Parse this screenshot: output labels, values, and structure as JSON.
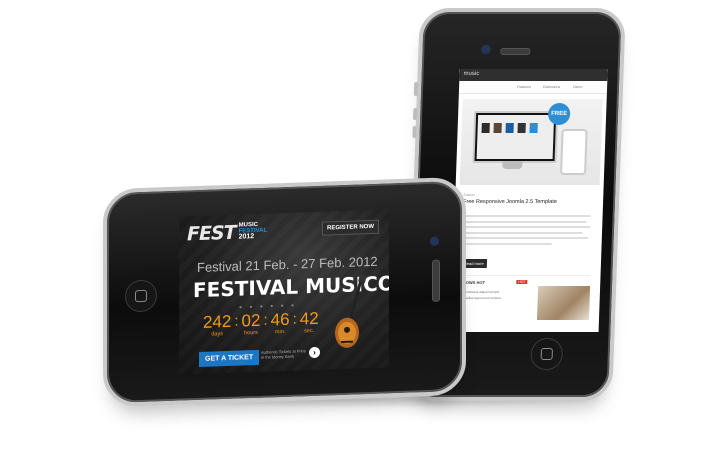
{
  "landscape_screen": {
    "logo_main": "FEST",
    "logo_music": "MUSIC",
    "logo_festival": "FESTIVAL",
    "logo_year": "2012",
    "register_label": "REGISTER NOW",
    "dates": "Festival 21 Feb. - 27 Feb. 2012",
    "title": "FESTIVAL MUSICO",
    "countdown": [
      {
        "value": "242",
        "unit": "days"
      },
      {
        "value": "02",
        "unit": "hours"
      },
      {
        "value": "46",
        "unit": "min."
      },
      {
        "value": "42",
        "unit": "sec."
      }
    ],
    "ticket_label": "GET A TICKET",
    "ticket_sub": "Authentic Tickets at Price in the Money Bank",
    "arrow": "›",
    "accent": "#f29a1a",
    "button_color": "#1d76c4"
  },
  "portrait_screen": {
    "logo": "music",
    "nav": [
      "Features",
      "Extensions",
      "Demo"
    ],
    "badge": "FREE",
    "category": "Articles",
    "heading": "Free Responsive Joomla 2.5 Template",
    "read_more": "Read more",
    "widget_title": "SHOWS HOT",
    "widget_badge": "HOT",
    "widget_items": [
      "Pellentesque aliquet tempor",
      "Phasellus eget purus tempus"
    ],
    "badge_color": "#2c8fd6"
  }
}
